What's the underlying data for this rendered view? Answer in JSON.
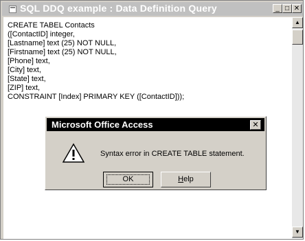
{
  "window": {
    "title": "SQL DDQ example : Data Definition Query",
    "minimize_label": "_",
    "maximize_label": "□",
    "close_label": "✕"
  },
  "editor": {
    "lines": [
      "CREATE TABEL Contacts",
      "([ContactID] integer,",
      "[Lastname] text (25) NOT NULL,",
      "[Firstname] text (25) NOT NULL,",
      "[Phone] text,",
      "[City] text,",
      "[State] text,",
      "[ZIP] text,",
      "CONSTRAINT [Index] PRIMARY KEY ([ContactID]));"
    ]
  },
  "scrollbar": {
    "up_label": "▲",
    "down_label": "▼"
  },
  "dialog": {
    "title": "Microsoft Office Access",
    "close_label": "✕",
    "message": "Syntax error in CREATE TABLE statement.",
    "ok_label": "OK",
    "help_label": "Help"
  }
}
